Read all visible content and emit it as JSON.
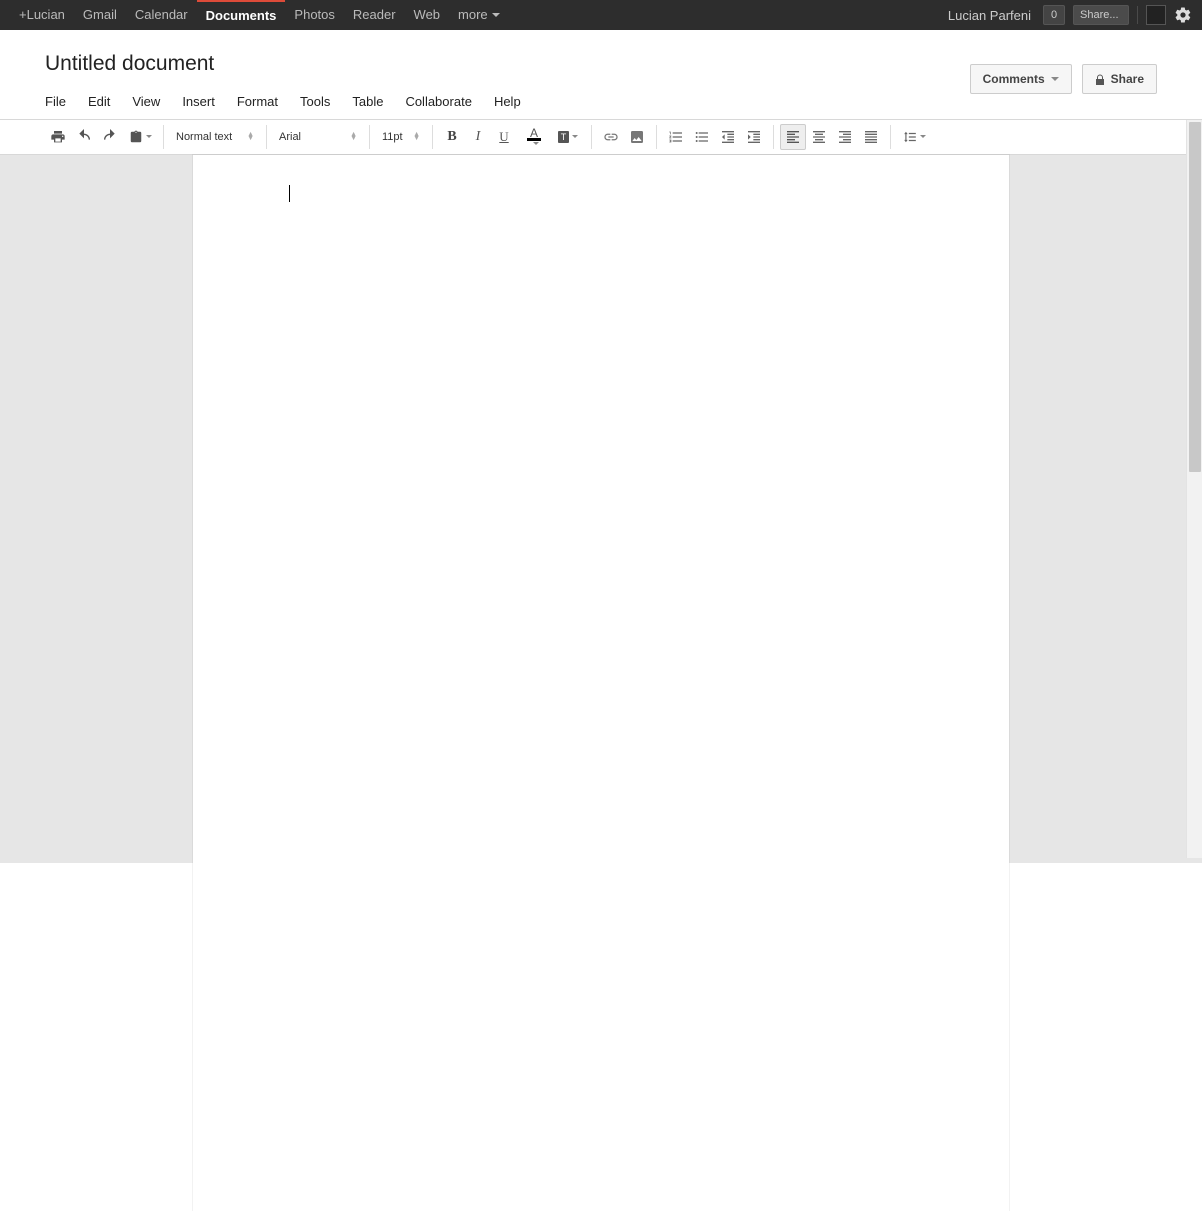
{
  "gbar": {
    "items": [
      "+Lucian",
      "Gmail",
      "Calendar",
      "Documents",
      "Photos",
      "Reader",
      "Web",
      "more"
    ],
    "activeIndex": 3,
    "user": "Lucian Parfeni",
    "count": "0",
    "share": "Share..."
  },
  "doc": {
    "title": "Untitled document",
    "menu": [
      "File",
      "Edit",
      "View",
      "Insert",
      "Format",
      "Tools",
      "Table",
      "Collaborate",
      "Help"
    ],
    "comments": "Comments",
    "share": "Share"
  },
  "toolbar": {
    "style": "Normal text",
    "font": "Arial",
    "size": "11pt"
  }
}
